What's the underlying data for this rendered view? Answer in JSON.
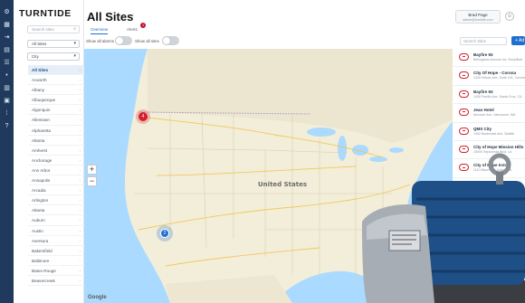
{
  "app": {
    "brand": "TURNTIDE",
    "page_title": "All Sites",
    "title_caret": "‹",
    "tabs": [
      {
        "label": "Overview",
        "selected": true
      },
      {
        "label": "Alerts",
        "selected": false
      }
    ],
    "alerts_badge": "1",
    "user": {
      "name": "Brad Page",
      "subtitle": "admin@turntide.com"
    }
  },
  "colors": {
    "accent": "#1f6fd1",
    "rail": "#1f3a5c",
    "alert": "#d2202e",
    "map_land": "#f3eed9",
    "water": "#aadaff"
  },
  "rail_icons": [
    "gear-icon",
    "grid-icon",
    "arrow-icon",
    "layers-icon",
    "list-icon",
    "dot-icon",
    "chart-icon",
    "building-icon",
    "users-icon",
    "help-icon"
  ],
  "sidebar": {
    "search_placeholder": "Search sites",
    "filter_1": "All Sites",
    "filter_2": "City",
    "items": [
      "All Sites",
      "Acworth",
      "Albany",
      "Albuquerque",
      "Algonquin",
      "Allentown",
      "Alpharetta",
      "Atlanta",
      "Amherst",
      "Anchorage",
      "Ann Arbor",
      "Annapolis",
      "Arcadia",
      "Arlington",
      "Atlanta",
      "Auburn",
      "Austin",
      "Aventura",
      "Bakersfield",
      "Baltimore",
      "Baton Rouge",
      "Beavercreek"
    ]
  },
  "toggles": {
    "show_all_alarms": "Show all alarms",
    "show_all_sites": "Show all sites"
  },
  "map": {
    "zoom_in": "+",
    "zoom_out": "−",
    "country_label": "United States",
    "marker_red_count": "4",
    "marker_blue_count": "2",
    "google_logo": "Google"
  },
  "right_panel": {
    "search_placeholder": "Search Sites",
    "add_label": "+ Ad",
    "items": [
      {
        "title": "Bayfire 93",
        "subtitle": "Bellingham Avenue Inc. Rock/Bolt"
      },
      {
        "title": "City Of Hope - Corona",
        "subtitle": "1430 Ketner Ave, Suite 101, Corona"
      },
      {
        "title": "Bayfire 93",
        "subtitle": "1430 Pacific Ave, Santa Cruz, CA"
      },
      {
        "title": "Jean Hotel",
        "subtitle": "Almonte Ave, Vancouver, WA"
      },
      {
        "title": "QMS City",
        "subtitle": "1400 Boulevard Ave, Seattle"
      },
      {
        "title": "City of Hope Mission Hills",
        "subtitle": "15000 Sepulveda Blvd, LA"
      },
      {
        "title": "City of Hope Irvine",
        "subtitle": "1110 Bison Ave, Irvine, CA"
      }
    ]
  }
}
